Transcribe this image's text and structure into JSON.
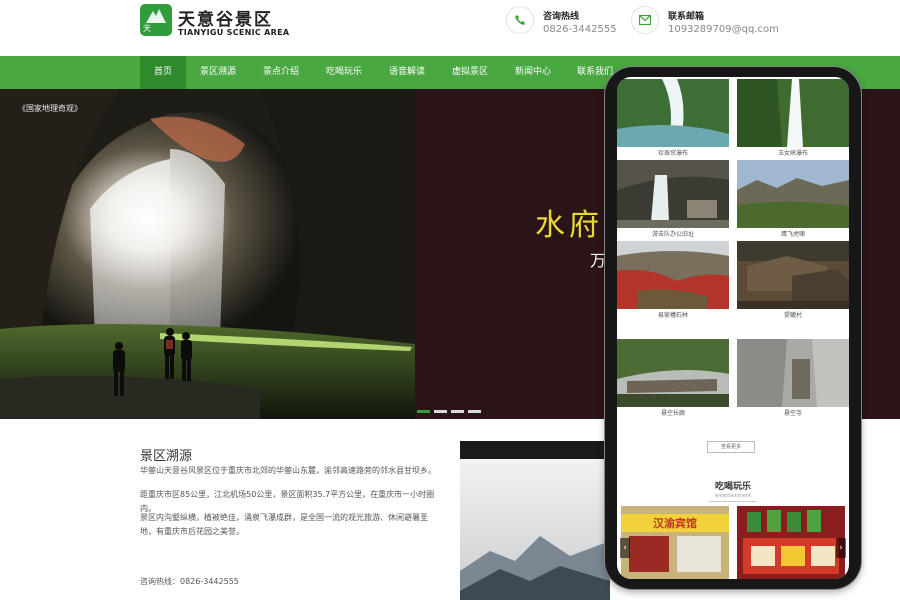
{
  "header": {
    "logo_icon_text": "天",
    "logo_cn": "天意谷景区",
    "logo_en": "TIANYIGU SCENIC AREA",
    "hotline_label": "咨询热线",
    "hotline_value": "0826-3442555",
    "email_label": "联系邮箱",
    "email_value": "1093289709@qq.com"
  },
  "nav": {
    "items": [
      "首页",
      "景区溯源",
      "景点介绍",
      "吃喝玩乐",
      "语音解读",
      "虚拟景区",
      "新闻中心",
      "联系我们"
    ],
    "active_index": 0
  },
  "banner": {
    "stamp": "《国家地理奇观》",
    "slogan_main": "水府",
    "slogan_sub": "万",
    "slides_total": 4,
    "active_slide": 0
  },
  "intro": {
    "title": "景区溯源",
    "p1": "华蓥山天意谷风景区位于重庆市北郊的华蓥山东麓，渝邻高速路旁的邻水县甘坝乡。",
    "p2": "距重庆市区85公里，江北机场50公里，景区面积35.7平方公里，在重庆市一小时圈内。",
    "p3": "景区内沟壑纵横，植被绝佳，涌泉飞瀑成群，是全国一流的观光旅游、休闲避暑圣地，有重庆市后花园之美誉。",
    "hotline": "咨询热线：0826-3442555"
  },
  "phone": {
    "spots": [
      "珍珠帘瀑布",
      "玉女峡瀑布",
      "游击队办公旧址",
      "鹰飞虎啸",
      "易家槽石林",
      "提罐村",
      "悬空长廊",
      "悬空寺"
    ],
    "more_button": "查看更多",
    "section_title": "吃喝玩乐",
    "section_sub": "entertainment",
    "store_sign": "汉渝宾馆"
  },
  "colors": {
    "brand_green": "#49a842",
    "nav_active": "#2f8a2c",
    "banner_bg": "#2b1418",
    "slogan_yellow": "#e8d832"
  }
}
